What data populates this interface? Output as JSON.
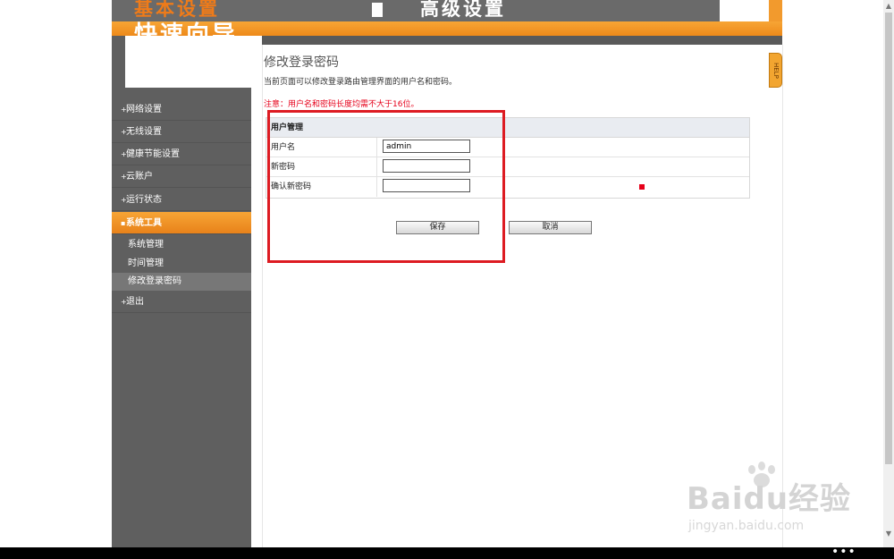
{
  "header": {
    "tab_basic": "基本设置",
    "tab_advanced": "高级设置",
    "quick_setup": "快速向导"
  },
  "help": {
    "label": "HELP"
  },
  "sidebar": {
    "items": [
      {
        "label": "网络设置"
      },
      {
        "label": "无线设置"
      },
      {
        "label": "健康节能设置"
      },
      {
        "label": "云账户"
      },
      {
        "label": "运行状态"
      },
      {
        "label": "系统工具"
      },
      {
        "label": "退出"
      }
    ],
    "subitems": [
      {
        "label": "系统管理"
      },
      {
        "label": "时间管理"
      },
      {
        "label": "修改登录密码"
      }
    ]
  },
  "main": {
    "title": "修改登录密码",
    "description": "当前页面可以修改登录路由管理界面的用户名和密码。",
    "note": "注意：用户名和密码长度均需不大于16位。",
    "form": {
      "header": "用户管理",
      "username_label": "用户名",
      "username_value": "admin",
      "new_password_label": "新密码",
      "new_password_value": "",
      "confirm_password_label": "确认新密码",
      "confirm_password_value": ""
    },
    "save_label": "保存",
    "cancel_label": "取消"
  },
  "watermark": {
    "logo": "Baidu经验",
    "url": "jingyan.baidu.com"
  },
  "taskbar": {
    "more": "•••"
  },
  "colors": {
    "accent": "#f29a2d",
    "sidebar": "#5f5f5f",
    "highlight": "#dd1b22",
    "note": "#e6001a"
  }
}
